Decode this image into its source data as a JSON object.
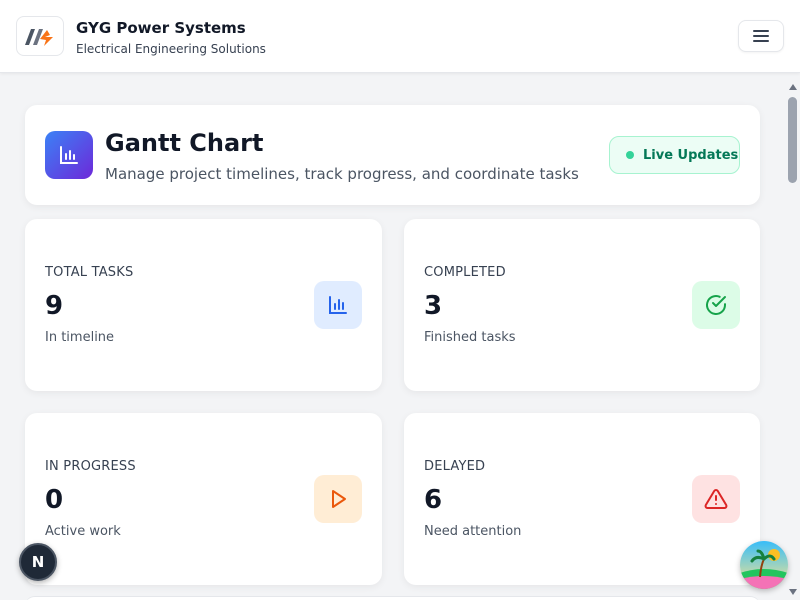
{
  "brand": {
    "name": "GYG Power Systems",
    "tagline": "Electrical Engineering Solutions",
    "logo_icon": "gyg-logo-icon"
  },
  "nav": {
    "menu_icon": "hamburger-menu-icon"
  },
  "header": {
    "title": "Gantt Chart",
    "subtitle": "Manage project timelines, track progress, and coordinate tasks",
    "icon": "bar-chart-icon",
    "live_label": "Live Updates",
    "live_color": "#34d399"
  },
  "stats": [
    {
      "label": "TOTAL TASKS",
      "value": "9",
      "sub": "In timeline",
      "icon": "bar-chart-icon",
      "accent": "#2563eb",
      "tint": "#e0ecff"
    },
    {
      "label": "COMPLETED",
      "value": "3",
      "sub": "Finished tasks",
      "icon": "check-circle-icon",
      "accent": "#16a34a",
      "tint": "#dcfce7"
    },
    {
      "label": "IN PROGRESS",
      "value": "0",
      "sub": "Active work",
      "icon": "play-icon",
      "accent": "#ea580c",
      "tint": "#ffedd5"
    },
    {
      "label": "DELAYED",
      "value": "6",
      "sub": "Need attention",
      "icon": "alert-triangle-icon",
      "accent": "#dc2626",
      "tint": "#fee2e2"
    }
  ],
  "overlay": {
    "n_badge": "N",
    "assistant_icon": "beach-avatar-icon"
  }
}
